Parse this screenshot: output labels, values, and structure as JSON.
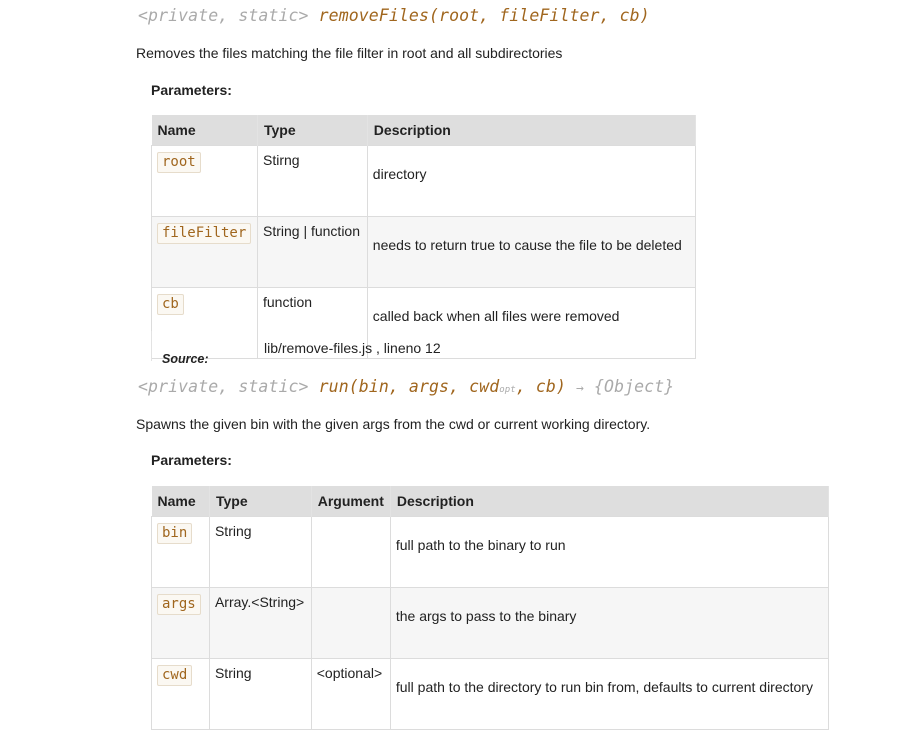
{
  "method1": {
    "attrs": "<private, static>",
    "name": "removeFiles",
    "params": "(root, fileFilter, cb)",
    "description": "Removes the files matching the file filter in root and all subdirectories",
    "params_heading": "Parameters:",
    "headers": [
      "Name",
      "Type",
      "Description"
    ],
    "rows": [
      {
        "name": "root",
        "type": "Stirng",
        "description": "directory"
      },
      {
        "name": "fileFilter",
        "type": "String | function",
        "description": "needs to return true to cause the file to be deleted"
      },
      {
        "name": "cb",
        "type": "function",
        "description": "called back when all files were removed"
      }
    ],
    "source_label": "Source:",
    "source_value": "lib/remove-files.js , lineno 12"
  },
  "method2": {
    "attrs": "<private, static>",
    "name": "run",
    "params_a": "(bin, args, cwd",
    "opt_marker": "opt",
    "params_b": ", cb)",
    "arrow": "→",
    "returns": "{Object}",
    "description": "Spawns the given bin with the given args from the cwd or current working directory.",
    "params_heading": "Parameters:",
    "headers": [
      "Name",
      "Type",
      "Argument",
      "Description"
    ],
    "rows": [
      {
        "name": "bin",
        "type": "String",
        "argument": "",
        "description": "full path to the binary to run"
      },
      {
        "name": "args",
        "type": "Array.<String>",
        "argument": "",
        "description": "the args to pass to the binary"
      },
      {
        "name": "cwd",
        "type": "String",
        "argument": "<optional>",
        "description": "full path to the directory to run bin from, defaults to current directory"
      }
    ]
  }
}
